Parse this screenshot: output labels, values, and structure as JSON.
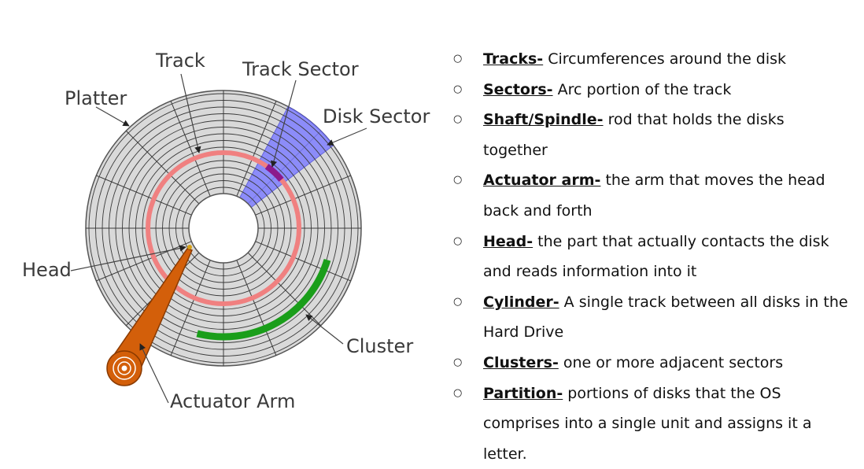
{
  "diagram": {
    "labels": {
      "track": "Track",
      "track_sector": "Track Sector",
      "platter": "Platter",
      "disk_sector": "Disk Sector",
      "head": "Head",
      "cluster": "Cluster",
      "actuator_arm": "Actuator Arm"
    },
    "colors": {
      "platter_fill": "#d9d9d9",
      "track_lines": "#3a3a3a",
      "highlight_track": "#f08080",
      "disk_sector": "#7f7fff",
      "track_sector": "#8b1a8b",
      "cluster": "#1a9e1a",
      "actuator_arm": "#d35f0a"
    }
  },
  "glossary": {
    "bullet_symbol": "○",
    "items": [
      {
        "term": "Tracks-",
        "definition": " Circumferences around the disk"
      },
      {
        "term": "Sectors-",
        "definition": " Arc portion of the track"
      },
      {
        "term": "Shaft/Spindle-",
        "definition": " rod that holds the disks together"
      },
      {
        "term": "Actuator arm-",
        "definition": " the arm that moves the head back and forth"
      },
      {
        "term": "Head-",
        "definition": " the part that actually contacts the disk and reads information into it"
      },
      {
        "term": "Cylinder-",
        "definition": " A single track between all disks in the Hard Drive"
      },
      {
        "term": "Clusters-",
        "definition": " one or more adjacent sectors"
      },
      {
        "term": "Partition-",
        "definition": " portions of disks that the OS comprises into a single unit and assigns it a letter."
      }
    ]
  }
}
